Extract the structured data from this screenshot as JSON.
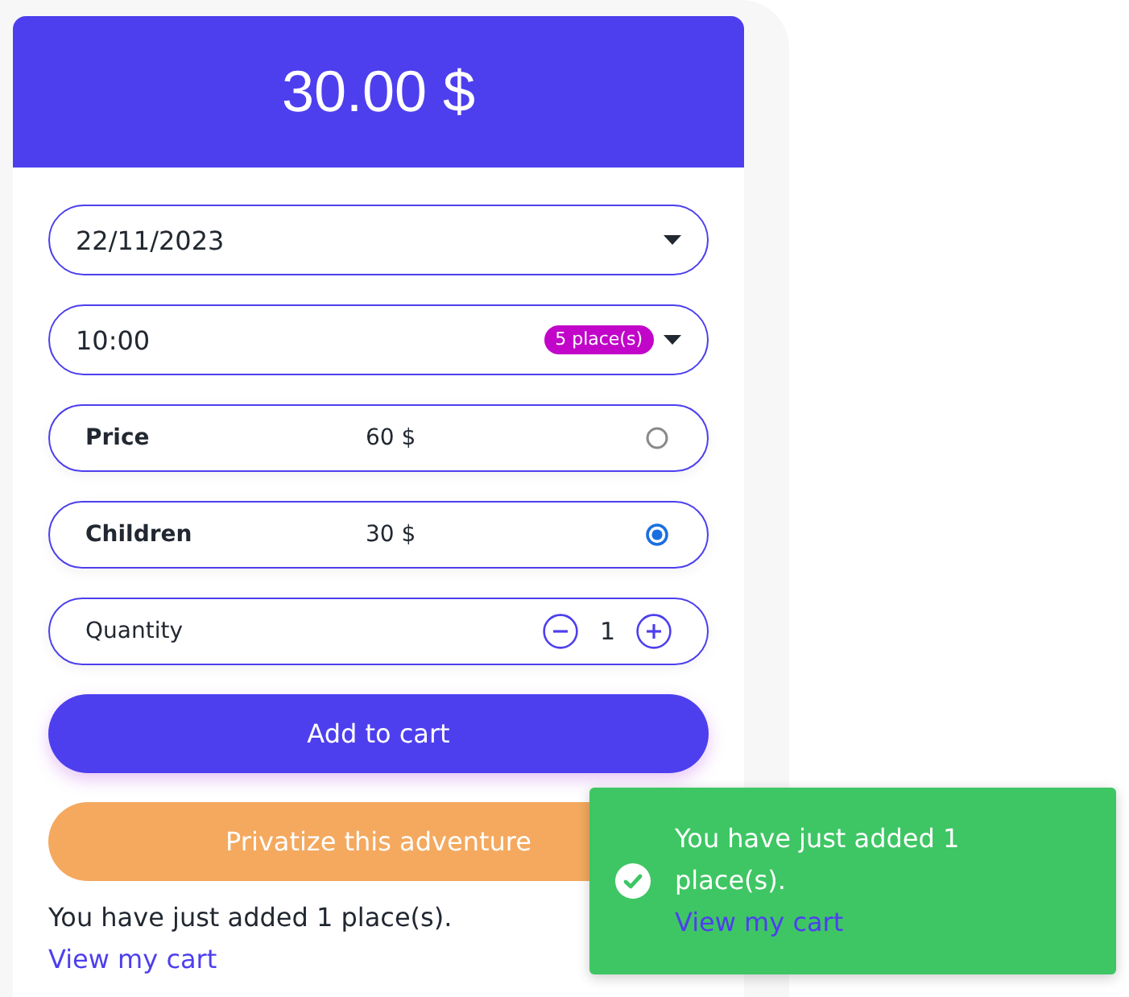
{
  "header": {
    "price": "30.00 $"
  },
  "date_select": {
    "value": "22/11/2023"
  },
  "time_select": {
    "value": "10:00",
    "badge": "5 place(s)"
  },
  "price_options": [
    {
      "label": "Price",
      "amount": "60 $",
      "selected": false
    },
    {
      "label": "Children",
      "amount": "30 $",
      "selected": true
    }
  ],
  "quantity": {
    "label": "Quantity",
    "value": "1"
  },
  "buttons": [
    {
      "kind": "primary",
      "label": "Add to cart"
    },
    {
      "kind": "secondary",
      "label": "Privatize this adventure"
    }
  ],
  "confirmation": {
    "message": "You have just added 1 place(s).",
    "link": "View my cart"
  },
  "toast": {
    "message": "You have just added 1 place(s).",
    "link": "View my cart"
  }
}
